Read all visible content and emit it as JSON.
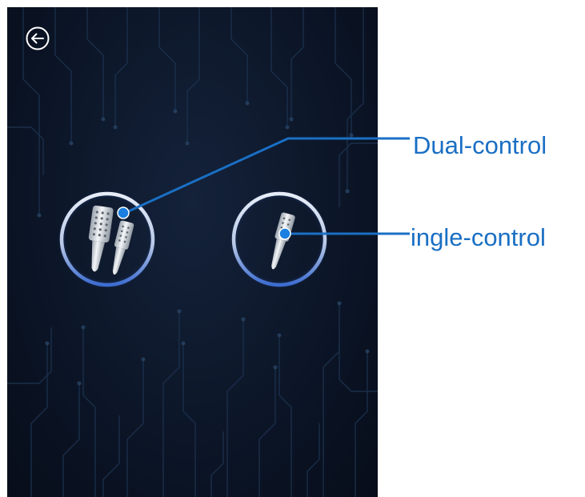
{
  "screen": {
    "background": "#0c1628",
    "back_button": {
      "icon": "back-arrow-icon"
    },
    "modes": [
      {
        "id": "dual",
        "icon": "dual-handpiece-icon"
      },
      {
        "id": "single",
        "icon": "single-handpiece-icon"
      }
    ]
  },
  "annotations": {
    "color": "#1a6fc4",
    "dual_label": "Dual-control",
    "single_label": "ingle-control"
  }
}
